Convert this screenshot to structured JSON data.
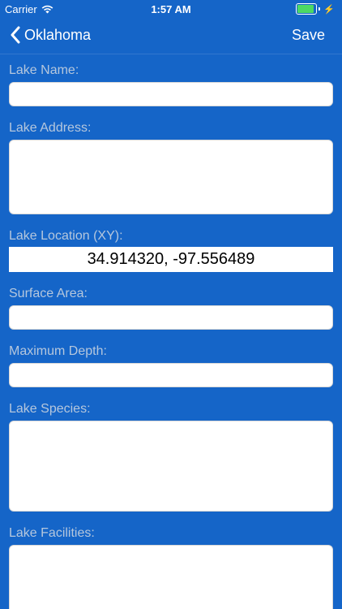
{
  "status_bar": {
    "carrier": "Carrier",
    "time": "1:57 AM"
  },
  "nav": {
    "back_label": "Oklahoma",
    "save_label": "Save"
  },
  "form": {
    "lake_name_label": "Lake Name:",
    "lake_address_label": "Lake Address:",
    "lake_location_label": "Lake Location (XY):",
    "lake_location_value": "34.914320, -97.556489",
    "surface_area_label": "Surface Area:",
    "maximum_depth_label": "Maximum Depth:",
    "lake_species_label": "Lake Species:",
    "lake_facilities_label": "Lake Facilities:"
  },
  "colors": {
    "background": "#1565c8",
    "label": "#b5c7dd",
    "battery": "#4cd964"
  },
  "battery_level": 0.9
}
